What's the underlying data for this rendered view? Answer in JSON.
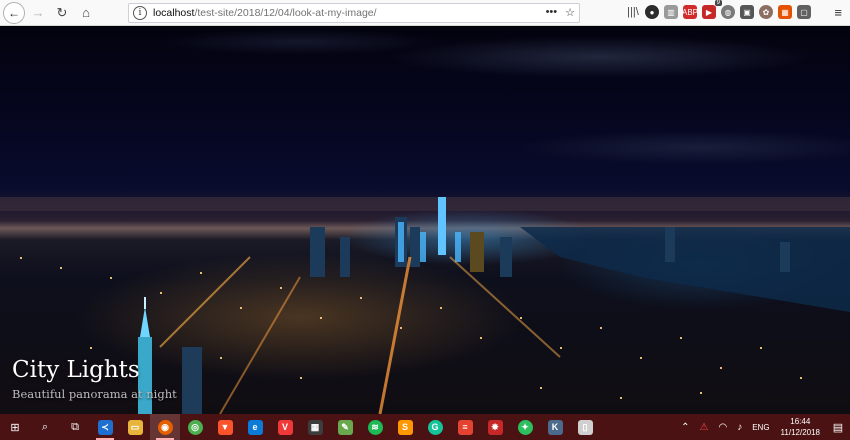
{
  "browser": {
    "url_host": "localhost",
    "url_path": "/test-site/2018/12/04/look-at-my-image/",
    "url_actions": {
      "more": "•••",
      "bookmark": "☆"
    },
    "nav": {
      "back": "←",
      "forward": "→",
      "reload": "↻",
      "home": "⌂"
    },
    "info": "i",
    "menu": "≡",
    "toolbar_icons": [
      {
        "name": "library-icon",
        "glyph": "|||\\",
        "color": "transparent"
      },
      {
        "name": "extension-dark-icon",
        "glyph": "●",
        "color": "#2b2b2b"
      },
      {
        "name": "reader-view-icon",
        "glyph": "▥",
        "color": "#9a9a9a"
      },
      {
        "name": "adblock-plus-icon",
        "glyph": "ABP",
        "color": "#d22b2b"
      },
      {
        "name": "extension-badge-icon",
        "glyph": "▶",
        "color": "#c62828",
        "badge": "9"
      },
      {
        "name": "extension-gray-icon",
        "glyph": "◍",
        "color": "#7a7a7a"
      },
      {
        "name": "extension-square-icon",
        "glyph": "▣",
        "color": "#555555"
      },
      {
        "name": "extension-leaf-icon",
        "glyph": "✿",
        "color": "#8d6e63"
      },
      {
        "name": "extension-orange-icon",
        "glyph": "▦",
        "color": "#e65100"
      },
      {
        "name": "extension-frame-icon",
        "glyph": "▢",
        "color": "#616161"
      }
    ]
  },
  "hero": {
    "title": "City Lights",
    "subtitle": "Beautiful panorama at night"
  },
  "taskbar": {
    "start": "⊞",
    "search": "⌕",
    "taskview": "⧉",
    "apps": [
      {
        "name": "vscode-icon",
        "glyph": "≺",
        "color": "#1f6fd0",
        "running": true
      },
      {
        "name": "file-explorer-icon",
        "glyph": "▭",
        "color": "#e9b43b",
        "running": false
      },
      {
        "name": "firefox-icon",
        "glyph": "◉",
        "color": "#e66000",
        "running": true,
        "active": true
      },
      {
        "name": "chrome-icon",
        "glyph": "◎",
        "color": "#4caf50",
        "running": false
      },
      {
        "name": "brave-icon",
        "glyph": "▼",
        "color": "#fb542b",
        "running": false
      },
      {
        "name": "edge-icon",
        "glyph": "e",
        "color": "#0a7bd6",
        "running": false
      },
      {
        "name": "vivaldi-icon",
        "glyph": "V",
        "color": "#ef3939",
        "running": false
      },
      {
        "name": "calculator-icon",
        "glyph": "▦",
        "color": "#3d3d3d",
        "running": false
      },
      {
        "name": "notepad-icon",
        "glyph": "✎",
        "color": "#6aa84f",
        "running": false
      },
      {
        "name": "spotify-icon",
        "glyph": "≋",
        "color": "#1db954",
        "running": false
      },
      {
        "name": "sublime-icon",
        "glyph": "S",
        "color": "#ff9800",
        "running": false
      },
      {
        "name": "grammarly-icon",
        "glyph": "G",
        "color": "#15c39a",
        "running": false
      },
      {
        "name": "todoist-icon",
        "glyph": "≡",
        "color": "#e44332",
        "running": false
      },
      {
        "name": "ladybug-icon",
        "glyph": "✸",
        "color": "#c62828",
        "running": false
      },
      {
        "name": "evernote-icon",
        "glyph": "✦",
        "color": "#2dbe60",
        "running": false
      },
      {
        "name": "k-app-icon",
        "glyph": "K",
        "color": "#4a6b8c",
        "running": false
      },
      {
        "name": "document-icon",
        "glyph": "▯",
        "color": "#d0d0d0",
        "running": false
      }
    ],
    "tray": {
      "chevron": "⌃",
      "acrobat": "⚠",
      "wifi": "◠",
      "volume": "♪",
      "language": "ENG",
      "time": "16:44",
      "date": "11/12/2018",
      "notifications": "▤"
    }
  }
}
